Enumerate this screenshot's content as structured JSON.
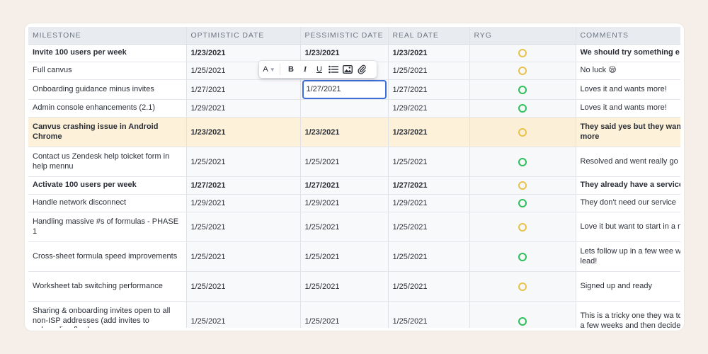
{
  "columns": [
    "MILESTONE",
    "OPTIMISTIC DATE",
    "PESSIMISTIC DATE",
    "REAL DATE",
    "RYG",
    "COMMENTS"
  ],
  "rows": [
    {
      "milestone": "Invite 100 users per week",
      "optimistic": "1/23/2021",
      "pessimistic": "1/23/2021",
      "real": "1/23/2021",
      "ryg": "yellow",
      "comment": "We should try something e",
      "bold": true
    },
    {
      "milestone": "Full canvus",
      "optimistic": "1/25/2021",
      "pessimistic": "",
      "real": "1/25/2021",
      "ryg": "yellow",
      "comment": "No luck 😪"
    },
    {
      "milestone": "Onboarding guidance minus invites",
      "optimistic": "1/27/2021",
      "pessimistic": "1/27/2021",
      "real": "1/27/2021",
      "ryg": "green",
      "comment": "Loves it and wants more!",
      "editing": true
    },
    {
      "milestone": "Admin console enhancements (2.1)",
      "optimistic": "1/29/2021",
      "pessimistic": "",
      "real": "1/29/2021",
      "ryg": "green",
      "comment": "Loves it and wants more!"
    },
    {
      "milestone": "Canvus crashing issue in Android Chrome",
      "optimistic": "1/23/2021",
      "pessimistic": "1/23/2021",
      "real": "1/23/2021",
      "ryg": "yellow",
      "comment": "They said yes but they wan to know some more",
      "bold": true,
      "highlight": true
    },
    {
      "milestone": "Contact us Zendesk help toicket form in help mennu",
      "optimistic": "1/25/2021",
      "pessimistic": "1/25/2021",
      "real": "1/25/2021",
      "ryg": "green",
      "comment": "Resolved and went really go"
    },
    {
      "milestone": "Activate 100 users per week",
      "optimistic": "1/27/2021",
      "pessimistic": "1/27/2021",
      "real": "1/27/2021",
      "ryg": "yellow",
      "comment": "They already have a service",
      "bold": true
    },
    {
      "milestone": "Handle network disconnect",
      "optimistic": "1/29/2021",
      "pessimistic": "1/29/2021",
      "real": "1/29/2021",
      "ryg": "green",
      "comment": "They don't need our service"
    },
    {
      "milestone": "Handling massive #s of formulas - PHASE 1",
      "optimistic": "1/25/2021",
      "pessimistic": "1/25/2021",
      "real": "1/25/2021",
      "ryg": "yellow",
      "comment": "Love it but want to start in a month not a week"
    },
    {
      "milestone": "Cross-sheet formula speed improvements",
      "optimistic": "1/25/2021",
      "pessimistic": "1/25/2021",
      "real": "1/25/2021",
      "ryg": "green",
      "comment": "Lets follow up in a few wee with this one 🔥 lead!"
    },
    {
      "milestone": "Worksheet tab switching performance",
      "optimistic": "1/25/2021",
      "pessimistic": "1/25/2021",
      "real": "1/25/2021",
      "ryg": "yellow",
      "comment": "Signed up and ready"
    },
    {
      "milestone": "Sharing & onboarding invites open to all non-ISP addresses (add invites to onboarding flow)",
      "optimistic": "1/25/2021",
      "pessimistic": "1/25/2021",
      "real": "1/25/2021",
      "ryg": "green",
      "comment": "This is a tricky one they wa to try our service for a few weeks and then decide"
    }
  ],
  "toolbar": {
    "text_color_label": "A",
    "bold_label": "B",
    "italic_label": "I",
    "underline_label": "U",
    "icons": [
      "text-color-icon",
      "bold-icon",
      "italic-icon",
      "underline-icon",
      "bullet-list-icon",
      "image-icon",
      "attachment-icon"
    ]
  },
  "colors": {
    "background": "#f6efe9",
    "header": "#e8ecf1",
    "highlight_row": "#fdf1d9",
    "ryg_yellow": "#e8c24a",
    "ryg_green": "#2fbf5a",
    "edit_border": "#3f6fd8"
  }
}
